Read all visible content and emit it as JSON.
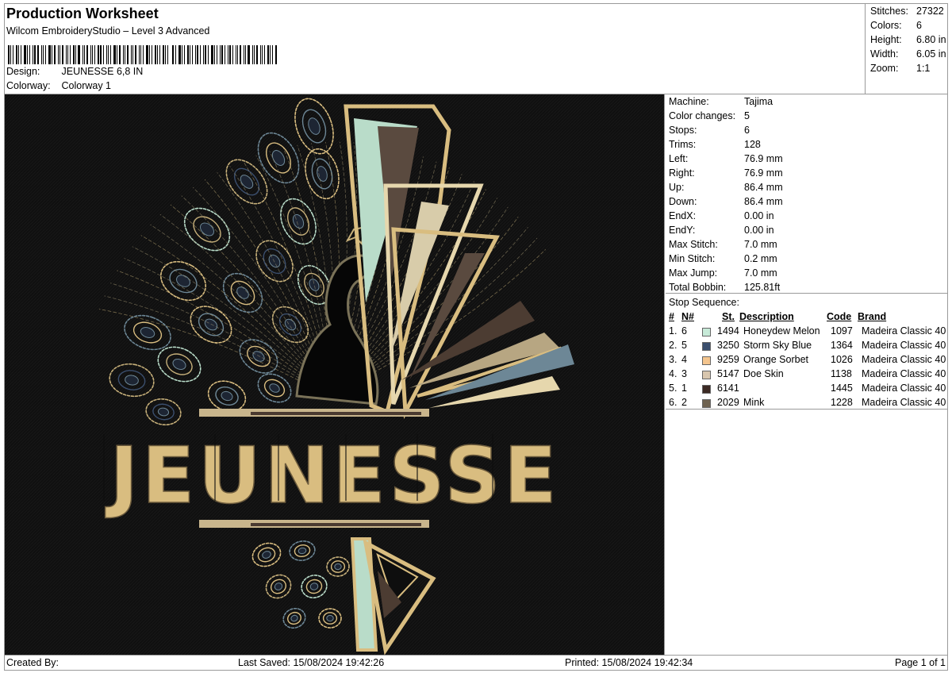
{
  "header": {
    "title": "Production Worksheet",
    "software": "Wilcom EmbroideryStudio – Level 3 Advanced",
    "barcode_label": "barcode",
    "design_label": "Design:",
    "design_value": "JEUNESSE 6,8 IN",
    "colorway_label": "Colorway:",
    "colorway_value": "Colorway 1"
  },
  "summary": [
    {
      "label": "Stitches:",
      "value": "27322"
    },
    {
      "label": "Colors:",
      "value": "6"
    },
    {
      "label": "Height:",
      "value": "6.80 in"
    },
    {
      "label": "Width:",
      "value": "6.05 in"
    },
    {
      "label": "Zoom:",
      "value": "1:1"
    }
  ],
  "design_preview": {
    "text": "JEUNESSE",
    "background": "#0e0e0e"
  },
  "machine_info": [
    {
      "label": "Machine:",
      "value": "Tajima"
    },
    {
      "label": "Color changes:",
      "value": "5"
    },
    {
      "label": "Stops:",
      "value": "6"
    },
    {
      "label": "Trims:",
      "value": "128"
    },
    {
      "label": "Left:",
      "value": "76.9 mm"
    },
    {
      "label": "Right:",
      "value": "76.9 mm"
    },
    {
      "label": "Up:",
      "value": "86.4 mm"
    },
    {
      "label": "Down:",
      "value": "86.4 mm"
    },
    {
      "label": "EndX:",
      "value": "0.00 in"
    },
    {
      "label": "EndY:",
      "value": "0.00 in"
    },
    {
      "label": "Max Stitch:",
      "value": "7.0 mm"
    },
    {
      "label": "Min Stitch:",
      "value": "0.2 mm"
    },
    {
      "label": "Max Jump:",
      "value": "7.0 mm"
    },
    {
      "label": "Total Bobbin:",
      "value": "125.81ft"
    }
  ],
  "stop_sequence": {
    "title": "Stop Sequence:",
    "headers": {
      "num": "#",
      "n": "N#",
      "st": "St.",
      "description": "Description",
      "code": "Code",
      "brand": "Brand"
    },
    "rows": [
      {
        "num": "1.",
        "n": "6",
        "color": "#c7ead8",
        "st": "1494",
        "description": "Honeydew Melon",
        "code": "1097",
        "brand": "Madeira Classic 40"
      },
      {
        "num": "2.",
        "n": "5",
        "color": "#3b4f6e",
        "st": "3250",
        "description": "Storm Sky Blue",
        "code": "1364",
        "brand": "Madeira Classic 40"
      },
      {
        "num": "3.",
        "n": "4",
        "color": "#f4c58e",
        "st": "9259",
        "description": "Orange Sorbet",
        "code": "1026",
        "brand": "Madeira Classic 40"
      },
      {
        "num": "4.",
        "n": "3",
        "color": "#d8c6ae",
        "st": "5147",
        "description": "Doe Skin",
        "code": "1138",
        "brand": "Madeira Classic 40"
      },
      {
        "num": "5.",
        "n": "1",
        "color": "#3c2a24",
        "st": "6141",
        "description": "",
        "code": "1445",
        "brand": "Madeira Classic 40"
      },
      {
        "num": "6.",
        "n": "2",
        "color": "#6e6250",
        "st": "2029",
        "description": "Mink",
        "code": "1228",
        "brand": "Madeira Classic 40"
      }
    ]
  },
  "footer": {
    "created_by": "Created By:",
    "last_saved": "Last Saved: 15/08/2024 19:42:26",
    "printed": "Printed: 15/08/2024 19:42:34",
    "page": "Page 1 of 1"
  }
}
